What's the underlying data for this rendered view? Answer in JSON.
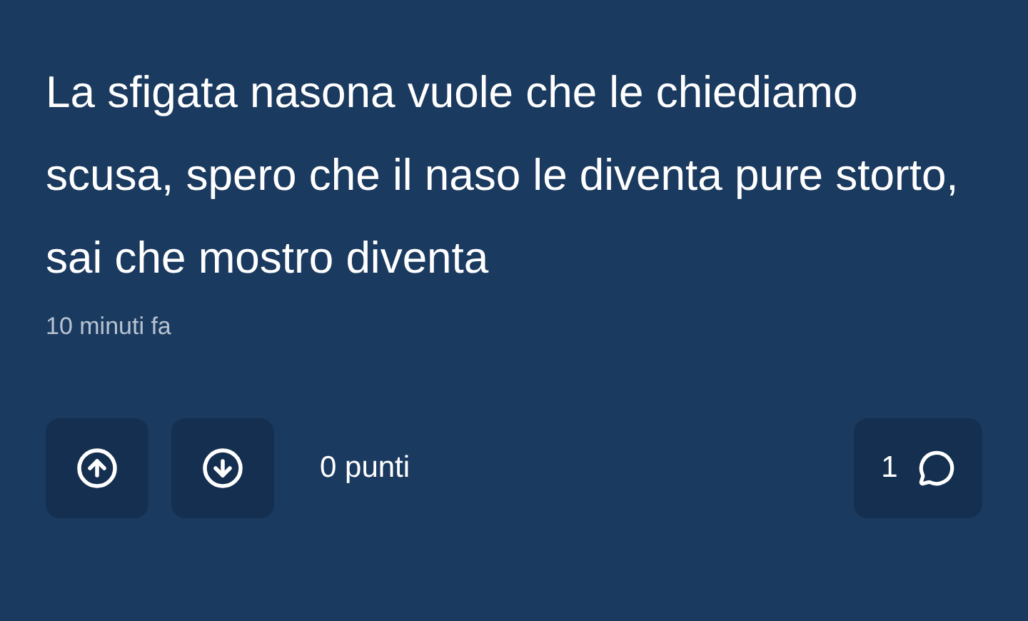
{
  "post": {
    "text": "La sfigata nasona vuole che le chiediamo scusa, spero che il naso le diventa pure storto, sai che mostro diventa",
    "time": "10 minuti fa"
  },
  "actions": {
    "score": "0 punti",
    "comments": "1"
  }
}
